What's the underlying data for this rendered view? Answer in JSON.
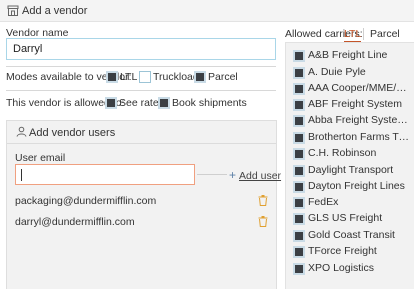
{
  "header": {
    "title": "Add a vendor"
  },
  "vendor_name": {
    "label": "Vendor name",
    "value": "Darryl"
  },
  "modes": {
    "label": "Modes available to vendor:",
    "options": [
      {
        "label": "LTL",
        "checked": true
      },
      {
        "label": "Truckload",
        "checked": false
      },
      {
        "label": "Parcel",
        "checked": true
      }
    ]
  },
  "permissions": {
    "label": "This vendor is allowed to:",
    "options": [
      {
        "label": "See rates",
        "checked": true
      },
      {
        "label": "Book shipments",
        "checked": true
      }
    ]
  },
  "users_panel": {
    "title": "Add vendor users",
    "email_label": "User email",
    "email_value": "",
    "add_user_label": "Add user",
    "emails": [
      "packaging@dundermifflin.com",
      "darryl@dundermifflin.com"
    ]
  },
  "carriers": {
    "label": "Allowed carriers:",
    "tabs": [
      {
        "label": "LTL",
        "active": true
      },
      {
        "label": "Parcel",
        "active": false
      }
    ],
    "items": [
      "A&B Freight Line",
      "A. Duie Pyle",
      "AAA Cooper/MME/DHE",
      "ABF Freight System",
      "Abba Freight Systems",
      "Brotherton Farms Trucking",
      "C.H. Robinson",
      "Daylight Transport",
      "Dayton Freight Lines",
      "FedEx",
      "GLS US Freight",
      "Gold Coast Transit",
      "TForce Freight",
      "XPO Logistics"
    ]
  },
  "colors": {
    "accent": "#c4552a",
    "checkbox_fill": "#3b3f44",
    "input_focus_border": "#f0a080",
    "trash": "#e0a030"
  }
}
